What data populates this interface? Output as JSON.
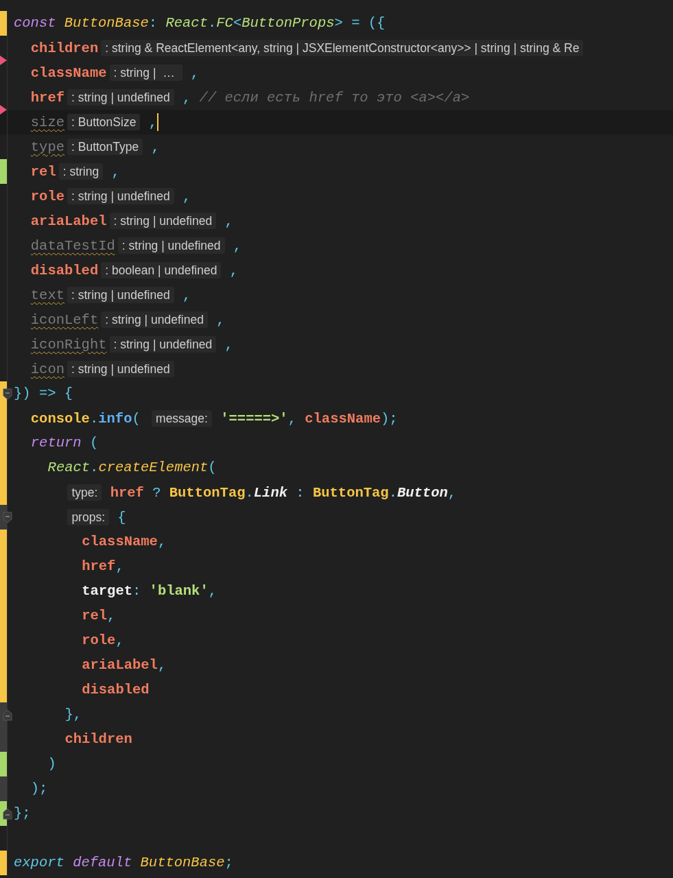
{
  "editor": {
    "lines": [
      {
        "color": "#f6c545",
        "tokens": [
          {
            "kind": "keyword",
            "text": "const "
          },
          {
            "kind": "decl",
            "text": "ButtonBase"
          },
          {
            "kind": "punct",
            "text": ": "
          },
          {
            "kind": "type",
            "text": "React"
          },
          {
            "kind": "punct",
            "text": "."
          },
          {
            "kind": "type",
            "text": "FC"
          },
          {
            "kind": "punct",
            "text": "<"
          },
          {
            "kind": "type",
            "text": "ButtonProps"
          },
          {
            "kind": "punct",
            "text": "> = ({"
          }
        ],
        "children": [
          {
            "deletion_below": true,
            "tokens": [
              {
                "kind": "param",
                "text": "children"
              },
              {
                "kind": "hint",
                "text": ": string & ReactElement<any, string | JSXElementConstructor<any>> | string | string & Re"
              }
            ]
          },
          {
            "tokens": [
              {
                "kind": "param",
                "text": "className"
              },
              {
                "kind": "hint",
                "text": ": string |  … "
              },
              {
                "kind": "punct",
                "text": " ,"
              }
            ]
          },
          {
            "deletion_below": true,
            "tokens": [
              {
                "kind": "param",
                "text": "href"
              },
              {
                "kind": "hint",
                "text": ": string | undefined"
              },
              {
                "kind": "punct",
                "text": " , "
              },
              {
                "kind": "comment",
                "text": "// если есть href то это <a></a>"
              }
            ]
          },
          {
            "current": true,
            "tokens": [
              {
                "kind": "unused",
                "text": "size"
              },
              {
                "kind": "hint",
                "text": ": ButtonSize"
              },
              {
                "kind": "punct",
                "text": " ,"
              }
            ]
          },
          {
            "tokens": [
              {
                "kind": "unused",
                "text": "type"
              },
              {
                "kind": "hint",
                "text": ": ButtonType"
              },
              {
                "kind": "punct",
                "text": " ,"
              }
            ]
          },
          {
            "color": "#a5d86a",
            "tokens": [
              {
                "kind": "param",
                "text": "rel"
              },
              {
                "kind": "hint",
                "text": ": string"
              },
              {
                "kind": "punct",
                "text": " ,"
              }
            ]
          },
          {
            "tokens": [
              {
                "kind": "param",
                "text": "role"
              },
              {
                "kind": "hint",
                "text": ": string | undefined"
              },
              {
                "kind": "punct",
                "text": " ,"
              }
            ]
          },
          {
            "tokens": [
              {
                "kind": "param",
                "text": "ariaLabel"
              },
              {
                "kind": "hint",
                "text": ": string | undefined"
              },
              {
                "kind": "punct",
                "text": " ,"
              }
            ]
          },
          {
            "tokens": [
              {
                "kind": "unused",
                "text": "dataTestId"
              },
              {
                "kind": "hint",
                "text": ": string | undefined"
              },
              {
                "kind": "punct",
                "text": " ,"
              }
            ]
          },
          {
            "tokens": [
              {
                "kind": "param",
                "text": "disabled"
              },
              {
                "kind": "hint",
                "text": ": boolean | undefined"
              },
              {
                "kind": "punct",
                "text": " ,"
              }
            ]
          },
          {
            "tokens": [
              {
                "kind": "unused",
                "text": "text"
              },
              {
                "kind": "hint",
                "text": ": string | undefined"
              },
              {
                "kind": "punct",
                "text": " ,"
              }
            ]
          },
          {
            "tokens": [
              {
                "kind": "unused",
                "text": "iconLeft"
              },
              {
                "kind": "hint",
                "text": ": string | undefined"
              },
              {
                "kind": "punct",
                "text": " ,"
              }
            ]
          },
          {
            "tokens": [
              {
                "kind": "unused",
                "text": "iconRight"
              },
              {
                "kind": "hint",
                "text": ": string | undefined"
              },
              {
                "kind": "punct",
                "text": " ,"
              }
            ]
          },
          {
            "tokens": [
              {
                "kind": "unused",
                "text": "icon"
              },
              {
                "kind": "hint",
                "text": ": string | undefined"
              }
            ]
          }
        ]
      },
      {
        "color": "#f6c545",
        "fold_start": true,
        "tokens": [
          {
            "kind": "punct",
            "text": "}) => {"
          }
        ],
        "children": [
          {
            "color": "#f6c545",
            "tokens": [
              {
                "kind": "class",
                "text": "console"
              },
              {
                "kind": "punct",
                "text": "."
              },
              {
                "kind": "method",
                "text": "info"
              },
              {
                "kind": "punct",
                "text": "( "
              },
              {
                "kind": "hint",
                "text": "message:"
              },
              {
                "kind": "string",
                "text": " '=====>'"
              },
              {
                "kind": "punct",
                "text": ", "
              },
              {
                "kind": "param",
                "text": "className"
              },
              {
                "kind": "punct",
                "text": ");"
              }
            ]
          },
          {
            "color": "#f6c545",
            "tokens": [
              {
                "kind": "keyword",
                "text": "return "
              },
              {
                "kind": "punct",
                "text": "("
              }
            ],
            "children": [
              {
                "color": "#f6c545",
                "tokens": [
                  {
                    "kind": "type",
                    "text": "React"
                  },
                  {
                    "kind": "punct",
                    "text": "."
                  },
                  {
                    "kind": "decl",
                    "text": "createElement"
                  },
                  {
                    "kind": "punct",
                    "text": "("
                  }
                ],
                "children": [
                  {
                    "color": "#f6c545",
                    "tokens": [
                      {
                        "kind": "hint",
                        "text": "type:"
                      },
                      {
                        "kind": "param",
                        "text": " href"
                      },
                      {
                        "kind": "punct",
                        "text": " ? "
                      },
                      {
                        "kind": "class",
                        "text": "ButtonTag"
                      },
                      {
                        "kind": "punct",
                        "text": "."
                      },
                      {
                        "kind": "member",
                        "text": "Link"
                      },
                      {
                        "kind": "punct",
                        "text": " : "
                      },
                      {
                        "kind": "class",
                        "text": "ButtonTag"
                      },
                      {
                        "kind": "punct",
                        "text": "."
                      },
                      {
                        "kind": "member",
                        "text": "Button"
                      },
                      {
                        "kind": "punct",
                        "text": ","
                      }
                    ]
                  },
                  {
                    "color": "#3c3c3c",
                    "fold_start": true,
                    "tokens": [
                      {
                        "kind": "hint",
                        "text": "props:"
                      },
                      {
                        "kind": "punct",
                        "text": " {"
                      }
                    ],
                    "children": [
                      {
                        "color": "#f6c545",
                        "tokens": [
                          {
                            "kind": "param",
                            "text": "className"
                          },
                          {
                            "kind": "punct",
                            "text": ","
                          }
                        ]
                      },
                      {
                        "color": "#f6c545",
                        "tokens": [
                          {
                            "kind": "param",
                            "text": "href"
                          },
                          {
                            "kind": "punct",
                            "text": ","
                          }
                        ]
                      },
                      {
                        "color": "#f6c545",
                        "tokens": [
                          {
                            "kind": "plain",
                            "text": "target"
                          },
                          {
                            "kind": "punct",
                            "text": ": "
                          },
                          {
                            "kind": "string",
                            "text": "'blank'"
                          },
                          {
                            "kind": "punct",
                            "text": ","
                          }
                        ]
                      },
                      {
                        "color": "#f6c545",
                        "tokens": [
                          {
                            "kind": "param",
                            "text": "rel"
                          },
                          {
                            "kind": "punct",
                            "text": ","
                          }
                        ]
                      },
                      {
                        "color": "#f6c545",
                        "tokens": [
                          {
                            "kind": "param",
                            "text": "role"
                          },
                          {
                            "kind": "punct",
                            "text": ","
                          }
                        ]
                      },
                      {
                        "color": "#f6c545",
                        "tokens": [
                          {
                            "kind": "param",
                            "text": "ariaLabel"
                          },
                          {
                            "kind": "punct",
                            "text": ","
                          }
                        ]
                      },
                      {
                        "color": "#f6c545",
                        "tokens": [
                          {
                            "kind": "param",
                            "text": "disabled"
                          }
                        ]
                      }
                    ]
                  },
                  {
                    "color": "#3c3c3c",
                    "fold_end": true,
                    "tokens": [
                      {
                        "kind": "punct",
                        "text": "},"
                      }
                    ]
                  },
                  {
                    "color": "#3c3c3c",
                    "tokens": [
                      {
                        "kind": "param",
                        "text": "children"
                      }
                    ]
                  }
                ]
              },
              {
                "color": "#a5d86a",
                "tokens": [
                  {
                    "kind": "punct",
                    "text": ")"
                  }
                ]
              }
            ]
          },
          {
            "color": "#3c3c3c",
            "tokens": [
              {
                "kind": "punct",
                "text": ");"
              }
            ]
          }
        ]
      },
      {
        "color": "#a5d86a",
        "fold_end": true,
        "tokens": [
          {
            "kind": "punct",
            "text": "};"
          }
        ]
      },
      {
        "color": "#f6c545",
        "blank_line_before": true,
        "tokens": [
          {
            "kind": "export",
            "text": "export "
          },
          {
            "kind": "keyword",
            "text": "default "
          },
          {
            "kind": "decl",
            "text": "ButtonBase"
          },
          {
            "kind": "punct",
            "text": ";"
          }
        ]
      }
    ]
  }
}
